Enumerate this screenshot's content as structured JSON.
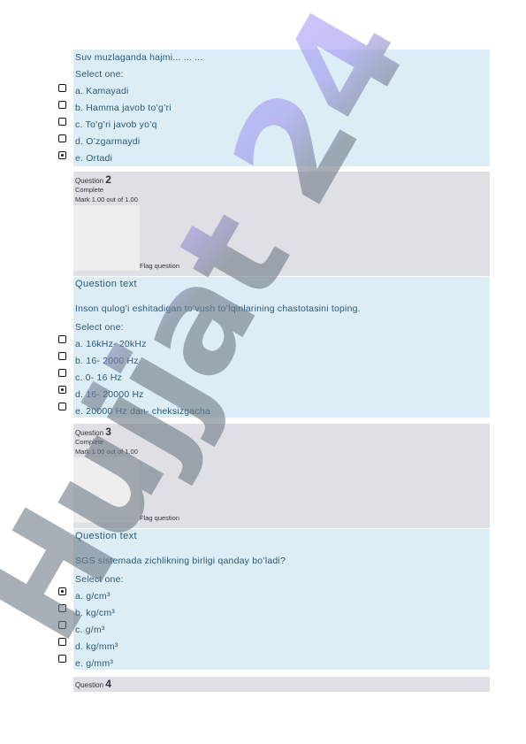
{
  "q1": {
    "question": "Suv muzlaganda hajmi... ... ...",
    "select_one": "Select one:",
    "options": [
      {
        "label": "a. Kamayadi",
        "checked": false
      },
      {
        "label": "b. Hamma javob to’g’ri",
        "checked": false
      },
      {
        "label": "c. To’g’ri javob yo’q",
        "checked": false
      },
      {
        "label": "d. O’zgarmaydi",
        "checked": false
      },
      {
        "label": "e. Ortadi",
        "checked": true
      }
    ]
  },
  "q2": {
    "prefix": "Question",
    "number": "2",
    "status": "Complete",
    "mark": "Mark 1.00 out of 1.00",
    "flag": "Flag question",
    "question_text_label": "Question text",
    "question": "Inson qulog’i eshitadigan to’vush to’lqinlarining chastotasini toping.",
    "select_one": "Select one:",
    "options": [
      {
        "label": "a. 16kHz- 20kHz",
        "checked": false
      },
      {
        "label": "b. 16-  2000 Hz",
        "checked": false
      },
      {
        "label": "c. 0- 16 Hz",
        "checked": false
      },
      {
        "label": "d. 16- 20000 Hz",
        "checked": true
      },
      {
        "label": "e. 20000 Hz dan-  cheksizgacha",
        "checked": false
      }
    ]
  },
  "q3": {
    "prefix": "Question",
    "number": "3",
    "status": "Complete",
    "mark": "Mark 1.00 out of 1.00",
    "flag": "Flag question",
    "question_text_label": "Question text",
    "question": "SGS sistemada zichlikning birligi qanday bo’ladi?",
    "select_one": "Select one:",
    "options": [
      {
        "label": "a. g/cm³",
        "checked": true
      },
      {
        "label": "b. kg/cm³",
        "checked": false
      },
      {
        "label": "c. g/m³",
        "checked": false
      },
      {
        "label": "d. kg/mm³",
        "checked": false
      },
      {
        "label": "e. g/mm³",
        "checked": false
      }
    ]
  },
  "q4": {
    "prefix": "Question",
    "number": "4"
  },
  "watermark": {
    "text": "Hujjat 24",
    "color": "#7a8590"
  }
}
